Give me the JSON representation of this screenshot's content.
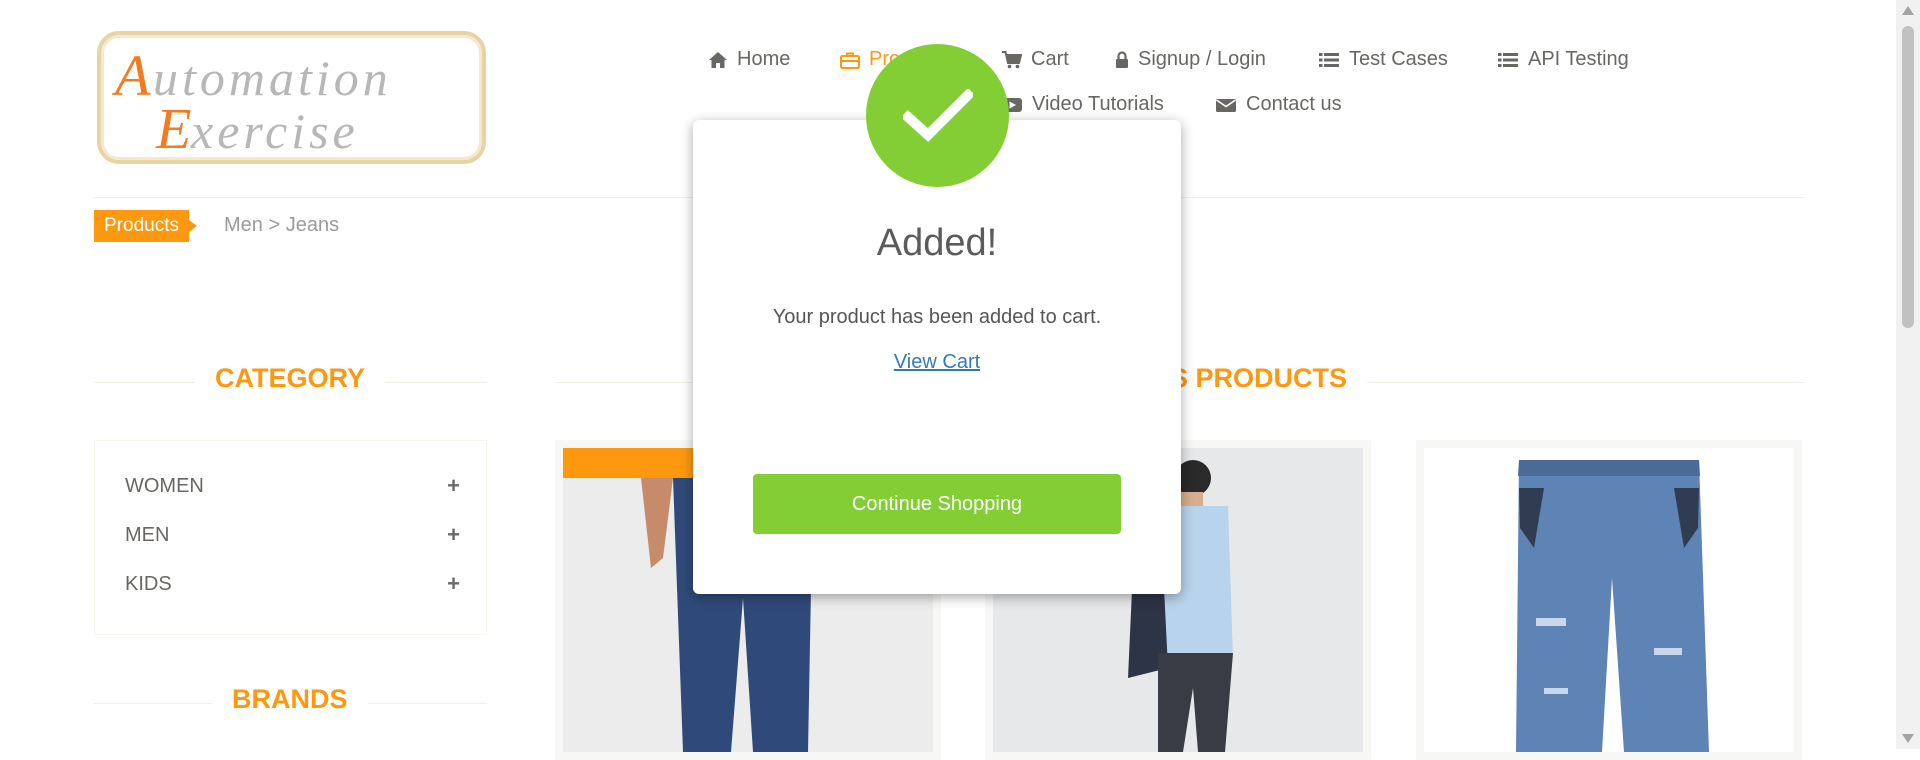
{
  "logo": {
    "line1": "Automation",
    "line2": "Exercise"
  },
  "nav": {
    "home": "Home",
    "products": "Products",
    "cart": "Cart",
    "signup_login": "Signup / Login",
    "test_cases": "Test Cases",
    "api_testing": "API Testing",
    "video_tutorials": "Video Tutorials",
    "contact_us": "Contact us"
  },
  "breadcrumb": {
    "tag": "Products",
    "path": "Men > Jeans"
  },
  "sidebar": {
    "category_title": "CATEGORY",
    "categories": [
      {
        "label": "WOMEN"
      },
      {
        "label": "MEN"
      },
      {
        "label": "KIDS"
      }
    ],
    "brands_title": "BRANDS"
  },
  "main": {
    "title": "MEN - JEANS PRODUCTS",
    "title_visible": "S PRODUCTS"
  },
  "modal": {
    "title": "Added!",
    "message": "Your product has been added to cart.",
    "link": "View Cart",
    "button": "Continue Shopping"
  },
  "colors": {
    "accent": "#fe980f",
    "success": "#83ce34",
    "link": "#337ab7",
    "text": "#696763"
  },
  "icons": [
    "home-icon",
    "briefcase-icon",
    "cart-icon",
    "lock-icon",
    "list-icon",
    "video-icon",
    "envelope-icon",
    "check-icon",
    "plus-icon"
  ]
}
